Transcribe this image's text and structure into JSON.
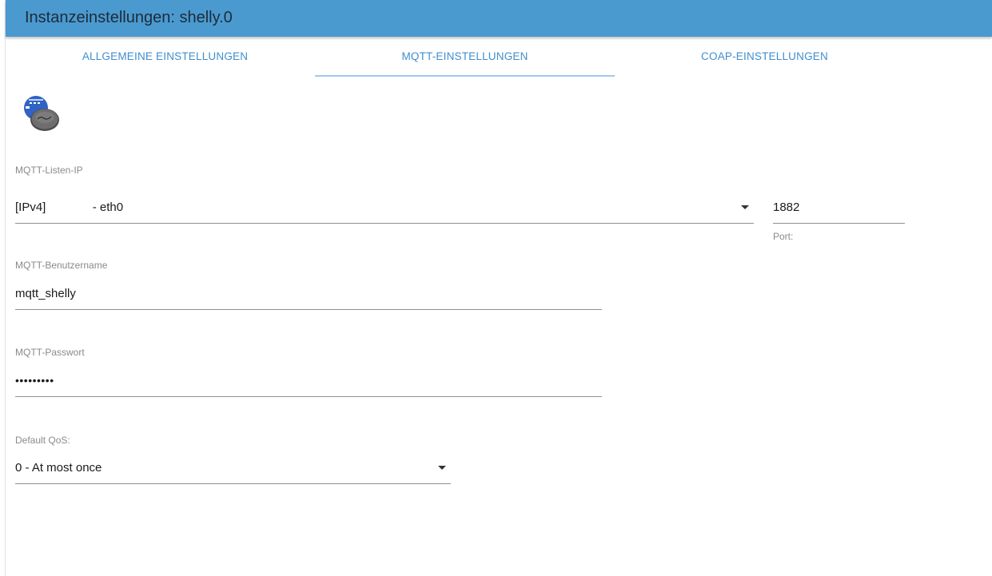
{
  "header": {
    "title": "Instanzeinstellungen: shelly.0"
  },
  "tabs": [
    {
      "label": "ALLGEMEINE EINSTELLUNGEN",
      "active": false
    },
    {
      "label": "MQTT-EINSTELLUNGEN",
      "active": true
    },
    {
      "label": "COAP-EINSTELLUNGEN",
      "active": false
    }
  ],
  "logo": {
    "icon": "shelly-logo-icon"
  },
  "mqtt_listen_ip": {
    "label": "MQTT-Listen-IP",
    "value": "[IPv4]              - eth0"
  },
  "port": {
    "value": "1882",
    "helper": "Port:"
  },
  "username": {
    "label": "MQTT-Benutzername",
    "value": "mqtt_shelly"
  },
  "password": {
    "label": "MQTT-Passwort",
    "value": "•••••••••"
  },
  "qos": {
    "label": "Default QoS:",
    "value": "0 - At most once"
  },
  "colors": {
    "header_bg": "#4a9ad0",
    "accent": "#3f8ecf",
    "tab_indicator": "#9fc9eb"
  }
}
